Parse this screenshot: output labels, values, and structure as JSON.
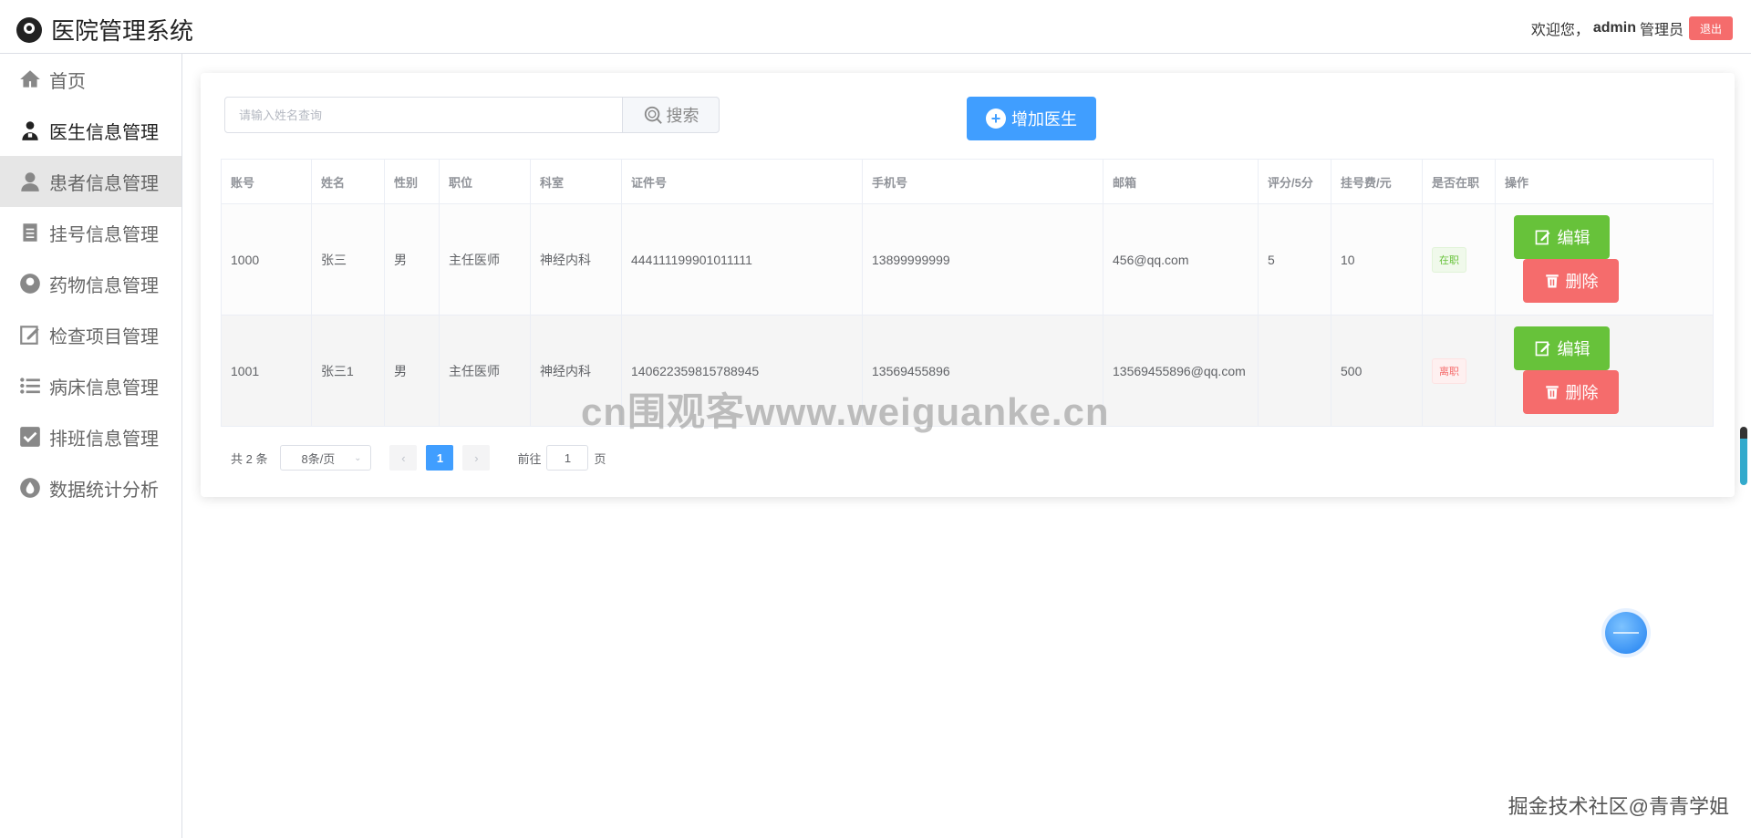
{
  "app": {
    "title": "医院管理系统"
  },
  "header": {
    "welcome": "欢迎您，",
    "username": "admin",
    "role": "管理员",
    "logout": "退出"
  },
  "sidebar": {
    "items": [
      {
        "label": "首页",
        "icon": "home-icon"
      },
      {
        "label": "医生信息管理",
        "icon": "doctor-icon"
      },
      {
        "label": "患者信息管理",
        "icon": "patient-icon"
      },
      {
        "label": "挂号信息管理",
        "icon": "register-doc-icon"
      },
      {
        "label": "药物信息管理",
        "icon": "medicine-icon"
      },
      {
        "label": "检查项目管理",
        "icon": "edit-icon"
      },
      {
        "label": "病床信息管理",
        "icon": "list-icon"
      },
      {
        "label": "排班信息管理",
        "icon": "checkbox-icon"
      },
      {
        "label": "数据统计分析",
        "icon": "drop-icon"
      }
    ]
  },
  "search": {
    "placeholder": "请输入姓名查询",
    "button": "搜索"
  },
  "toolbar": {
    "add_label": "增加医生"
  },
  "table": {
    "headers": [
      "账号",
      "姓名",
      "性别",
      "职位",
      "科室",
      "证件号",
      "手机号",
      "邮箱",
      "评分/5分",
      "挂号费/元",
      "是否在职",
      "操作"
    ],
    "rows": [
      {
        "account": "1000",
        "name": "张三",
        "gender": "男",
        "position": "主任医师",
        "dept": "神经内科",
        "id_no": "444111199901011111",
        "phone": "13899999999",
        "email": "456@qq.com",
        "score": "5",
        "fee": "10",
        "status": "在职"
      },
      {
        "account": "1001",
        "name": "张三1",
        "gender": "男",
        "position": "主任医师",
        "dept": "神经内科",
        "id_no": "140622359815788945",
        "phone": "13569455896",
        "email": "13569455896@qq.com",
        "score": "",
        "fee": "500",
        "status": "离职"
      }
    ],
    "edit_label": "编辑",
    "delete_label": "删除"
  },
  "pagination": {
    "total": "共 2 条",
    "page_size": "8条/页",
    "current": "1",
    "goto_label": "前往",
    "goto_value": "1",
    "page_suffix": "页"
  },
  "watermark": {
    "center": "cn围观客www.weiguanke.cn",
    "corner": "掘金技术社区@青青学姐"
  },
  "colors": {
    "primary": "#409eff",
    "success": "#67c23a",
    "danger": "#f56c6c"
  }
}
